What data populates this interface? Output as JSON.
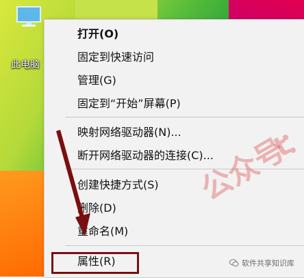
{
  "desktop": {
    "icon_label": "此电脑"
  },
  "context_menu": {
    "items": [
      {
        "label": "打开(O)",
        "bold": true
      },
      {
        "label": "固定到快速访问"
      },
      {
        "label": "管理(G)"
      },
      {
        "label": "固定到“开始”屏幕(P)"
      },
      {
        "label": "映射网络驱动器(N)..."
      },
      {
        "label": "断开网络驱动器的连接(C)..."
      },
      {
        "label": "创建快捷方式(S)"
      },
      {
        "label": "删除(D)"
      },
      {
        "label": "重命名(M)"
      },
      {
        "label": "属性(R)"
      }
    ]
  },
  "annotations": {
    "watermark": "公众号：",
    "watermark_tail": "t",
    "badge_text": "软件共享知识库",
    "highlight_color": "#7a0f0f",
    "arrow_color": "#7a0f0f"
  }
}
